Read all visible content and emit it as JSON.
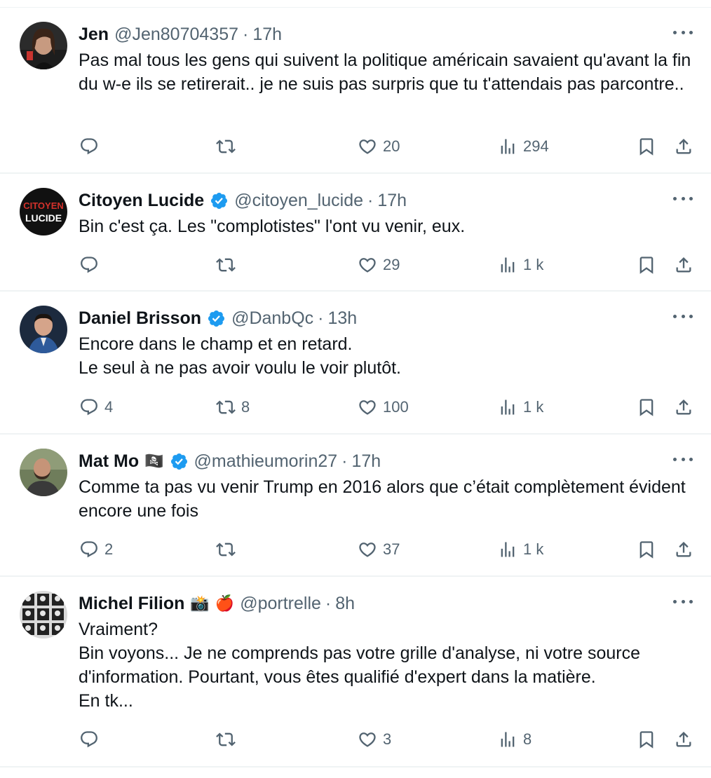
{
  "tweets": [
    {
      "name": "Jen",
      "handle": "@Jen80704357",
      "sep": "·",
      "time": "17h",
      "verified": false,
      "emojis": [],
      "text": "Pas mal tous les gens qui suivent la politique américain savaient qu'avant la fin du w-e ils se retirerait.. je ne suis pas surpris que tu t'attendais pas parcontre..",
      "replies": "",
      "retweets": "",
      "likes": "20",
      "views": "294",
      "avatar": {
        "type": "photo",
        "bg": "#2b2b2b",
        "accent": "#c8342f"
      }
    },
    {
      "name": "Citoyen Lucide",
      "handle": "@citoyen_lucide",
      "sep": "·",
      "time": "17h",
      "verified": true,
      "emojis": [],
      "text": "Bin c'est ça. Les \"complotistes\" l'ont vu venir, eux.",
      "replies": "",
      "retweets": "",
      "likes": "29",
      "views": "1 k",
      "avatar": {
        "type": "logo",
        "bg": "#111111",
        "line1": "CITOYEN",
        "line2": "LUCIDE",
        "line1_color": "#d3312b",
        "line2_color": "#ffffff"
      }
    },
    {
      "name": "Daniel Brisson",
      "handle": "@DanbQc",
      "sep": "·",
      "time": "13h",
      "verified": true,
      "emojis": [],
      "text": "Encore dans le champ et en retard.\nLe seul à ne pas avoir voulu le voir plutôt.",
      "replies": "4",
      "retweets": "8",
      "likes": "100",
      "views": "1 k",
      "avatar": {
        "type": "photo",
        "bg": "#1c2a3e",
        "accent": "#2e5a9a"
      }
    },
    {
      "name": "Mat Mo",
      "handle": "@mathieumorin27",
      "sep": "·",
      "time": "17h",
      "verified": true,
      "emojis": [
        "🏴‍☠️"
      ],
      "text": "Comme ta pas vu venir Trump en 2016 alors que c’était complètement évident encore une fois",
      "replies": "2",
      "retweets": "",
      "likes": "37",
      "views": "1 k",
      "avatar": {
        "type": "photo",
        "bg": "#6f7d5b",
        "accent": "#3a3a3a"
      }
    },
    {
      "name": "Michel Filion",
      "handle": "@portrelle",
      "sep": "·",
      "time": "8h",
      "verified": false,
      "emojis": [
        "📸",
        "🍎"
      ],
      "text": "Vraiment?\nBin voyons... Je ne comprends pas votre grille d'analyse, ni votre source d'information. Pourtant, vous êtes qualifié d'expert dans la matière.\nEn tk...",
      "replies": "",
      "retweets": "",
      "likes": "3",
      "views": "8",
      "avatar": {
        "type": "grid",
        "bg": "#d9d9d9",
        "accent": "#222222"
      }
    }
  ],
  "colors": {
    "text": "#0f1419",
    "muted": "#536471",
    "verified": "#1d9bf0",
    "divider": "#eff3f4"
  },
  "icons": [
    "reply-icon",
    "retweet-icon",
    "like-icon",
    "views-icon",
    "bookmark-icon",
    "share-icon",
    "more-icon",
    "verified-badge-icon"
  ]
}
